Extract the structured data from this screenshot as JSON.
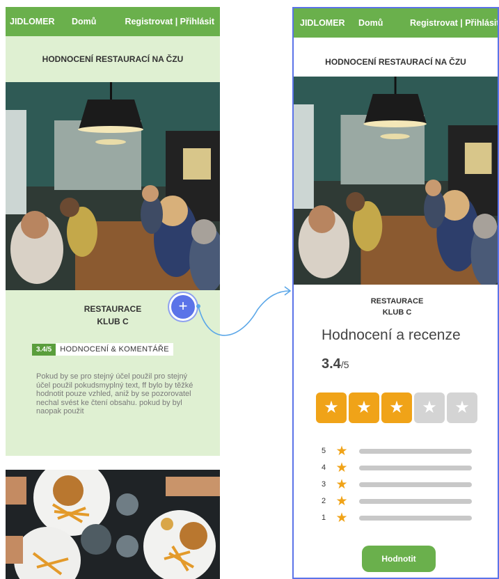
{
  "left": {
    "nav": {
      "brand": "JIDLOMER",
      "home": "Domů",
      "auth": "Registrovat | Přihlásit"
    },
    "page_title": "HODNOCENÍ RESTAURACÍ NA ČZU",
    "restaurant": {
      "line1": "RESTAURACE",
      "line2": "KLUB C"
    },
    "fab_label": "+",
    "score_badge": "3.4/5",
    "score_label": "HODNOCENÍ  & KOMENTÁŘE",
    "description": "Pokud by se pro stejný účel použil pro stejný účel použil  pokudsmyplný text, ff bylo by těžké hodnotit pouze vzhled, aniž by se pozorovatel nechal svést ke čtení obsahu. pokud by byl naopak použit"
  },
  "right": {
    "nav": {
      "brand": "JIDLOMER",
      "home": "Domů",
      "auth": "Registrovat | Přihlásit"
    },
    "page_title": "HODNOCENÍ RESTAURACÍ NA ČZU",
    "restaurant": {
      "line1": "RESTAURACE",
      "line2": "KLUB C"
    },
    "heading": "Hodnocení  a recenze",
    "score_value": "3.4",
    "score_max": "/5",
    "stars_filled": 3,
    "stars_total": 5,
    "distribution_levels": [
      "5",
      "4",
      "3",
      "2",
      "1"
    ],
    "rate_button": "Hodnotit"
  },
  "colors": {
    "green": "#6ab04c",
    "light_green": "#dff0d2",
    "orange": "#f0a318",
    "blue": "#5b73e8"
  },
  "icons": {
    "star": "★",
    "plus": "+"
  }
}
